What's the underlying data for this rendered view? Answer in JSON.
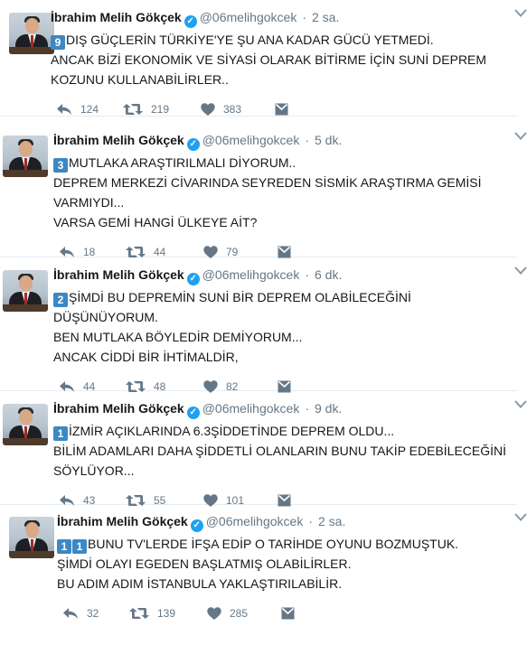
{
  "tweets": [
    {
      "author": "İbrahim Melih Gökçek",
      "handle": "@06melihgokcek",
      "time": "2 sa.",
      "badge": "9",
      "lines": [
        "DIŞ GÜÇLERİN TÜRKİYE'YE ŞU ANA KADAR GÜCÜ YETMEDİ.",
        "ANCAK BİZİ EKONOMİK VE SİYASİ OLARAK BİTİRME İÇİN SUNİ DEPREM",
        "KOZUNU KULLANABİLİRLER.."
      ],
      "replies": "124",
      "retweets": "219",
      "likes": "383"
    },
    {
      "author": "İbrahim Melih Gökçek",
      "handle": "@06melihgokcek",
      "time": "5 dk.",
      "badge": "3",
      "lines": [
        "MUTLAKA ARAŞTIRILMALI DİYORUM..",
        "DEPREM MERKEZİ CİVARINDA SEYREDEN SİSMİK ARAŞTIRMA GEMİSİ",
        "VARMIYDI...",
        "VARSA GEMİ HANGİ ÜLKEYE AİT?"
      ],
      "replies": "18",
      "retweets": "44",
      "likes": "79"
    },
    {
      "author": "İbrahim Melih Gökçek",
      "handle": "@06melihgokcek",
      "time": "6 dk.",
      "badge": "2",
      "lines": [
        "ŞİMDİ BU DEPREMİN SUNİ BİR DEPREM OLABİLECEĞİNİ",
        "DÜŞÜNÜYORUM.",
        "BEN MUTLAKA BÖYLEDİR DEMİYORUM...",
        "ANCAK CİDDİ BİR İHTİMALDİR,"
      ],
      "replies": "44",
      "retweets": "48",
      "likes": "82"
    },
    {
      "author": "İbrahim Melih Gökçek",
      "handle": "@06melihgokcek",
      "time": "9 dk.",
      "badge": "1",
      "lines": [
        "İZMİR AÇIKLARINDA 6.3ŞİDDETİNDE DEPREM OLDU...",
        "BİLİM ADAMLARI DAHA ŞİDDETLİ OLANLARIN BUNU TAKİP EDEBİLECEĞİNİ",
        "SÖYLÜYOR..."
      ],
      "replies": "43",
      "retweets": "55",
      "likes": "101"
    },
    {
      "author": "İbrahim Melih Gökçek",
      "handle": "@06melihgokcek",
      "time": "2 sa.",
      "badge": "1",
      "badge2": "1",
      "lines": [
        "BUNU TV'LERDE İFŞA EDİP O TARİHDE OYUNU BOZMUŞTUK.",
        "ŞİMDİ OLAYI EGEDEN BAŞLATMIŞ OLABİLİRLER.",
        "BU ADIM ADIM İSTANBULA YAKLAŞTIRILABİLİR."
      ],
      "replies": "32",
      "retweets": "139",
      "likes": "285"
    }
  ],
  "separator_dot": "·",
  "colors": {
    "verified": "#1da1f2",
    "keycap": "#3b88c3",
    "muted": "#657786"
  },
  "icons": [
    "verified-icon",
    "caret-down-icon",
    "reply-icon",
    "retweet-icon",
    "like-icon",
    "direct-message-icon"
  ]
}
